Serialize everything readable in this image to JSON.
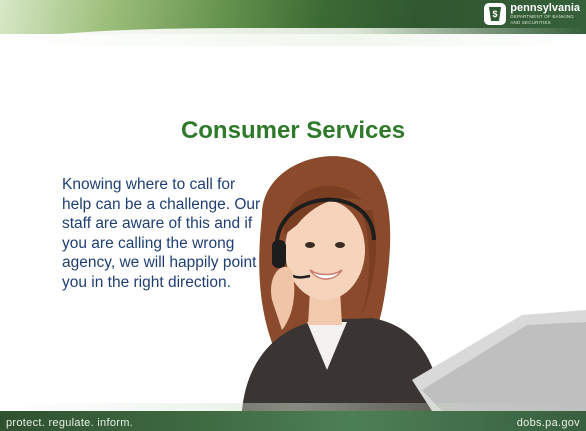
{
  "logo": {
    "name": "pennsylvania",
    "subtitle_line1": "DEPARTMENT OF BANKING",
    "subtitle_line2": "AND SECURITIES"
  },
  "title": "Consumer Services",
  "body": "Knowing where to call for help can be a challenge. Our staff are aware of this and if you are calling the wrong agency, we will happily point you in the right direction.",
  "footer": {
    "left": "protect. regulate. inform.",
    "right": "dobs.pa.gov"
  },
  "colors": {
    "title": "#2f7a2a",
    "body_text": "#1f3f73",
    "band_dark": "#2f5730"
  },
  "image": "woman-with-headset-and-laptop"
}
